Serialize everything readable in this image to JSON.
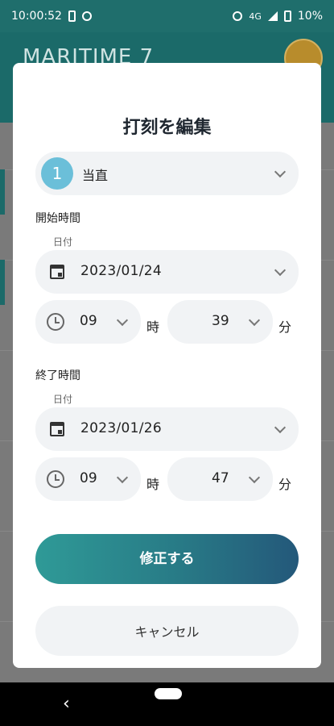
{
  "status": {
    "time": "10:00:52",
    "network": "4G",
    "battery": "10%"
  },
  "app": {
    "title": "MARITIME 7"
  },
  "modal": {
    "title": "打刻を編集",
    "duty_type": {
      "number": "1",
      "label": "当直"
    },
    "start": {
      "section": "開始時間",
      "date_label": "日付",
      "date": "2023/01/24",
      "hour": "09",
      "hour_unit": "時",
      "minute": "39",
      "minute_unit": "分"
    },
    "end": {
      "section": "終了時間",
      "date_label": "日付",
      "date": "2023/01/26",
      "hour": "09",
      "hour_unit": "時",
      "minute": "47",
      "minute_unit": "分"
    },
    "submit_label": "修正する",
    "cancel_label": "キャンセル"
  },
  "nav": {
    "back_glyph": "‹"
  },
  "colors": {
    "accent": "#2f9a97",
    "accent_dark": "#24587a",
    "badge": "#6bbfd9",
    "appbar": "#1b6a69"
  }
}
